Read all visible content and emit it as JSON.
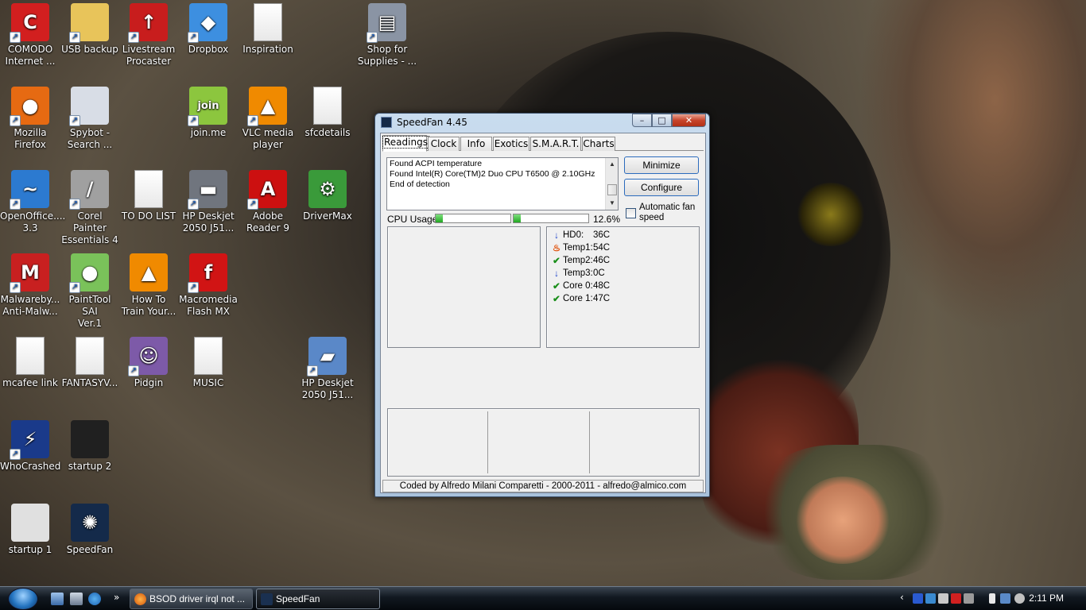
{
  "desktop": {
    "icons": [
      {
        "label": "COMODO\nInternet ...",
        "name": "comodo-icon",
        "color": "#d21f1f",
        "glyph": "C",
        "sc": true
      },
      {
        "label": "USB backup",
        "name": "usb-backup-icon",
        "color": "#e8c45a",
        "glyph": "",
        "sc": true
      },
      {
        "label": "Livestream\nProcaster",
        "name": "livestream-icon",
        "color": "#c81d1d",
        "glyph": "↑",
        "sc": true
      },
      {
        "label": "Dropbox",
        "name": "dropbox-icon",
        "color": "#3d8fe0",
        "glyph": "◆",
        "sc": true
      },
      {
        "label": "Inspiration",
        "name": "document-icon",
        "color": "",
        "glyph": "",
        "sc": false,
        "doc": true
      },
      {
        "label": "Shop for\nSupplies - ...",
        "name": "printer-shop-icon",
        "color": "#8a94a4",
        "glyph": "▤",
        "sc": true
      },
      {
        "label": "Mozilla\nFirefox",
        "name": "firefox-icon",
        "color": "#e66a12",
        "glyph": "●",
        "sc": true
      },
      {
        "label": "Spybot -\nSearch ...",
        "name": "spybot-icon",
        "color": "#d8dde6",
        "glyph": "",
        "sc": true
      },
      {
        "label": "join.me",
        "name": "joinme-icon",
        "color": "#8cc63e",
        "glyph": "join",
        "sc": true
      },
      {
        "label": "VLC media\nplayer",
        "name": "vlc-icon",
        "color": "#f08a00",
        "glyph": "▲",
        "sc": true
      },
      {
        "label": "sfcdetails",
        "name": "document-icon",
        "color": "",
        "glyph": "",
        "sc": false,
        "doc": true
      },
      {
        "label": "OpenOffice....\n3.3",
        "name": "openoffice-icon",
        "color": "#2c7ad0",
        "glyph": "~",
        "sc": true
      },
      {
        "label": "Corel Painter\nEssentials 4",
        "name": "corel-painter-icon",
        "color": "#a0a0a0",
        "glyph": "/",
        "sc": true
      },
      {
        "label": "TO DO LIST",
        "name": "document-icon",
        "color": "",
        "glyph": "",
        "sc": false,
        "doc": true
      },
      {
        "label": "HP Deskjet\n2050 J51...",
        "name": "hp-printer-icon",
        "color": "#70757e",
        "glyph": "▬",
        "sc": true
      },
      {
        "label": "Adobe\nReader 9",
        "name": "adobe-reader-icon",
        "color": "#cc1010",
        "glyph": "A",
        "sc": true
      },
      {
        "label": "DriverMax",
        "name": "drivermax-icon",
        "color": "#3a9a3a",
        "glyph": "⚙",
        "sc": false
      },
      {
        "label": "Malwareby...\nAnti-Malw...",
        "name": "malwarebytes-icon",
        "color": "#c82020",
        "glyph": "M",
        "sc": true
      },
      {
        "label": "PaintTool SAI\nVer.1",
        "name": "painttool-sai-icon",
        "color": "#7ac25a",
        "glyph": "●",
        "sc": true
      },
      {
        "label": "How To\nTrain Your...",
        "name": "vlc-icon",
        "color": "#f08a00",
        "glyph": "▲",
        "sc": false
      },
      {
        "label": "Macromedia\nFlash MX",
        "name": "flash-icon",
        "color": "#d11414",
        "glyph": "f",
        "sc": true
      },
      {
        "label": "mcafee link",
        "name": "document-icon",
        "color": "",
        "glyph": "",
        "sc": false,
        "doc": true
      },
      {
        "label": "FANTASYV...",
        "name": "document-icon",
        "color": "",
        "glyph": "",
        "sc": false,
        "doc": true
      },
      {
        "label": "Pidgin",
        "name": "pidgin-icon",
        "color": "#7d5aa8",
        "glyph": "☺",
        "sc": true
      },
      {
        "label": "MUSIC",
        "name": "document-icon",
        "color": "",
        "glyph": "",
        "sc": false,
        "doc": true
      },
      {
        "label": "HP Deskjet\n2050 J51...",
        "name": "hp-scanner-icon",
        "color": "#5a88c8",
        "glyph": "▰",
        "sc": true
      },
      {
        "label": "WhoCrashed",
        "name": "whocrashed-icon",
        "color": "#1a3a8a",
        "glyph": "⚡",
        "sc": true
      },
      {
        "label": "startup 2",
        "name": "screenshot-icon",
        "color": "#202020",
        "glyph": "",
        "sc": false
      },
      {
        "label": "startup 1",
        "name": "screenshot-icon",
        "color": "#e0e0e0",
        "glyph": "",
        "sc": false
      },
      {
        "label": "SpeedFan",
        "name": "speedfan-icon",
        "color": "#142a4a",
        "glyph": "✺",
        "sc": false
      }
    ]
  },
  "window": {
    "title": "SpeedFan 4.45",
    "controls": {
      "minimize": "–",
      "maximize": "□",
      "close": "✕"
    },
    "tabs": [
      "Readings",
      "Clock",
      "Info",
      "Exotics",
      "S.M.A.R.T.",
      "Charts"
    ],
    "log_lines": [
      "Found ACPI temperature",
      "Found Intel(R) Core(TM)2 Duo CPU T6500 @ 2.10GHz",
      "End of detection"
    ],
    "buttons": {
      "minimize": "Minimize",
      "configure": "Configure"
    },
    "cpu_usage_label": "CPU Usage",
    "cpu_bars": [
      0.1,
      0.1
    ],
    "cpu_percent": "12.6%",
    "auto_fan_label": "Automatic fan speed",
    "temps": [
      {
        "icon": "arrow-down",
        "name": "HD0:",
        "value": "36C"
      },
      {
        "icon": "flame",
        "name": "Temp1:",
        "value": "54C"
      },
      {
        "icon": "check",
        "name": "Temp2:",
        "value": "46C"
      },
      {
        "icon": "arrow-down",
        "name": "Temp3:",
        "value": "0C"
      },
      {
        "icon": "check",
        "name": "Core 0:",
        "value": "48C"
      },
      {
        "icon": "check",
        "name": "Core 1:",
        "value": "47C"
      }
    ],
    "footer": "Coded by Alfredo Milani Comparetti - 2000-2011 - alfredo@almico.com"
  },
  "taskbar": {
    "buttons": [
      {
        "label": "BSOD driver irql not ...",
        "icon": "firefox-icon"
      },
      {
        "label": "SpeedFan",
        "icon": "speedfan-icon"
      }
    ],
    "clock": "2:11 PM",
    "overflow": "»"
  }
}
